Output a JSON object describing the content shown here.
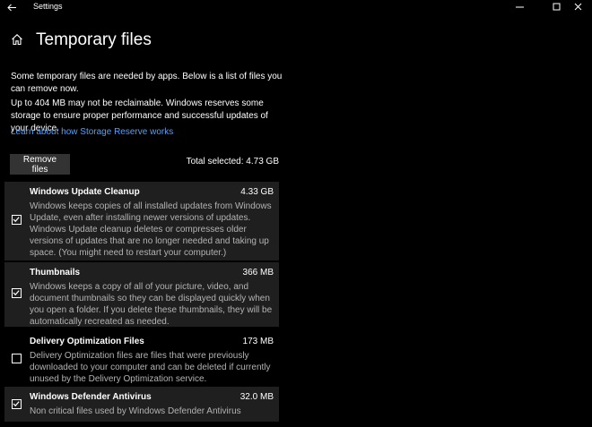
{
  "window": {
    "title": "Settings",
    "back_icon": "back-arrow-icon",
    "minimize": "—",
    "maximize": "☐",
    "close": "✕"
  },
  "header": {
    "title": "Temporary files",
    "home_icon": "home-icon"
  },
  "intro": {
    "line1": "Some temporary files are needed by apps. Below is a list of files you can remove now.",
    "line2": "Up to 404 MB may not be reclaimable. Windows reserves some storage to ensure proper performance and successful updates of your device.",
    "link": "Learn about how Storage Reserve works"
  },
  "actions": {
    "remove_label": "Remove files",
    "total_selected": "Total selected: 4.73 GB"
  },
  "items": [
    {
      "title": "Windows Update Cleanup",
      "size": "4.33 GB",
      "checked": true,
      "description": "Windows keeps copies of all installed updates from Windows Update, even after installing newer versions of updates. Windows Update cleanup deletes or compresses older versions of updates that are no longer needed and taking up space. (You might need to restart your computer.)"
    },
    {
      "title": "Thumbnails",
      "size": "366 MB",
      "checked": true,
      "description": "Windows keeps a copy of all of your picture, video, and document thumbnails so they can be displayed quickly when you open a folder. If you delete these thumbnails, they will be automatically recreated as needed."
    },
    {
      "title": "Delivery Optimization Files",
      "size": "173 MB",
      "checked": false,
      "description": "Delivery Optimization files are files that were previously downloaded to your computer and can be deleted if currently unused by the Delivery Optimization service."
    },
    {
      "title": "Windows Defender Antivirus",
      "size": "32.0 MB",
      "checked": true,
      "description": "Non critical files used by Windows Defender Antivirus"
    }
  ],
  "colors": {
    "background": "#000000",
    "item_shaded": "#1f1f1f",
    "button": "#333333",
    "link": "#4ea1ff",
    "description": "#b3b3b3"
  }
}
